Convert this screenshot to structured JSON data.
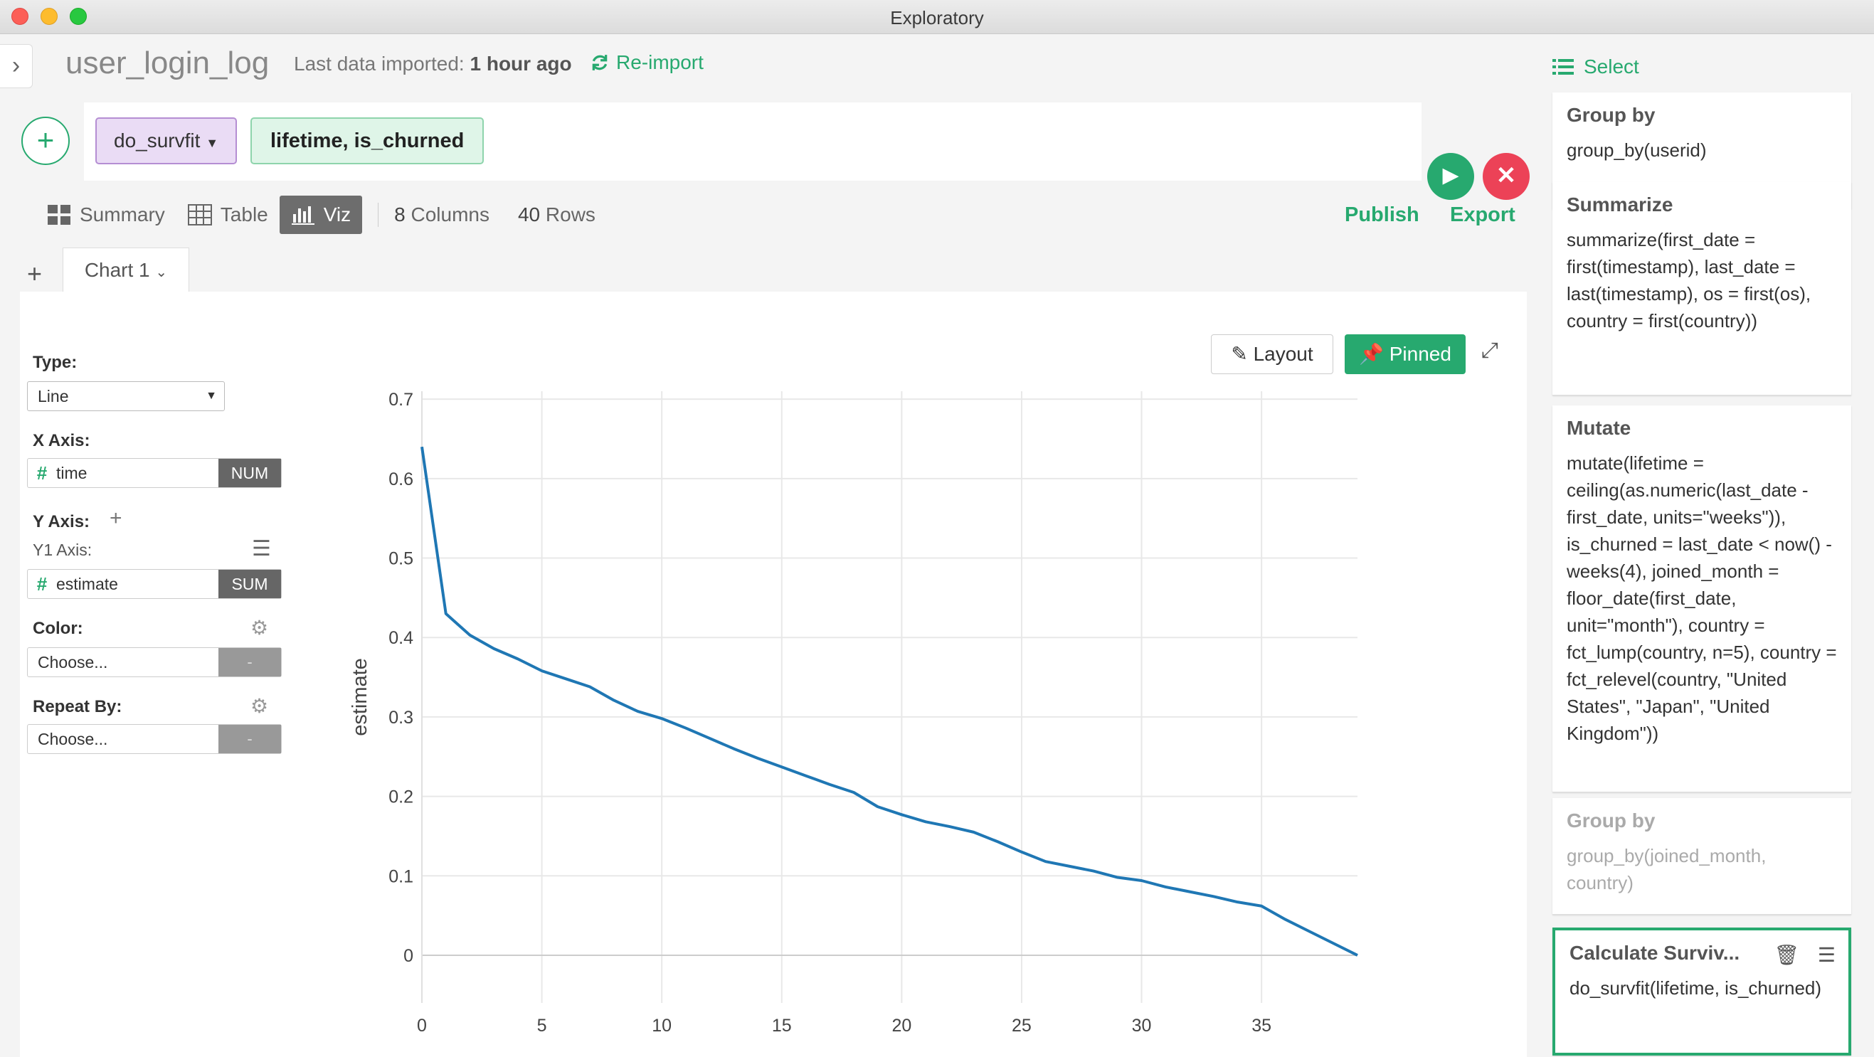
{
  "window": {
    "title": "Exploratory"
  },
  "header": {
    "dataset_name": "user_login_log",
    "last_import_label": "Last data imported:",
    "last_import_value": "1 hour ago",
    "reimport_label": "Re-import"
  },
  "command": {
    "name": "do_survfit",
    "args": "lifetime, is_churned"
  },
  "view_tabs": [
    {
      "label": "Summary"
    },
    {
      "label": "Table"
    },
    {
      "label": "Viz"
    }
  ],
  "stats": {
    "columns_num": "8",
    "columns_label": "Columns",
    "rows_num": "40",
    "rows_label": "Rows"
  },
  "actions": {
    "publish": "Publish",
    "export": "Export"
  },
  "chart_tabs": [
    {
      "label": "Chart 1"
    }
  ],
  "config": {
    "type_label": "Type:",
    "type_value": "Line",
    "x_axis_label": "X Axis:",
    "x_field": "time",
    "x_agg": "NUM",
    "y_axis_label": "Y Axis:",
    "y1_label": "Y1 Axis:",
    "y_field": "estimate",
    "y_agg": "SUM",
    "color_label": "Color:",
    "color_value": "Choose...",
    "repeat_label": "Repeat By:",
    "repeat_value": "Choose...",
    "dash": "-"
  },
  "chart_buttons": {
    "layout": "Layout",
    "pinned": "Pinned"
  },
  "chart_data": {
    "type": "line",
    "xlabel": "time",
    "ylabel": "estimate",
    "xlim": [
      0,
      39
    ],
    "ylim": [
      -0.06,
      0.71
    ],
    "xticks": [
      0,
      5,
      10,
      15,
      20,
      25,
      30,
      35
    ],
    "yticks": [
      0,
      0.1,
      0.2,
      0.3,
      0.4,
      0.5,
      0.6,
      0.7
    ],
    "ytick_labels": [
      "0",
      "0.1",
      "0.2",
      "0.3",
      "0.4",
      "0.5",
      "0.6",
      "0.7"
    ],
    "grid": true,
    "series": [
      {
        "color": "#1f77b4",
        "x": [
          0,
          1,
          2,
          3,
          4,
          5,
          6,
          7,
          8,
          9,
          10,
          11,
          12,
          13,
          14,
          15,
          16,
          17,
          18,
          19,
          20,
          21,
          22,
          23,
          24,
          25,
          26,
          27,
          28,
          29,
          30,
          31,
          32,
          33,
          34,
          35,
          36,
          37,
          38,
          39
        ],
        "y": [
          0.64,
          0.43,
          0.403,
          0.386,
          0.373,
          0.358,
          0.348,
          0.338,
          0.321,
          0.307,
          0.298,
          0.286,
          0.273,
          0.26,
          0.248,
          0.237,
          0.226,
          0.215,
          0.205,
          0.187,
          0.177,
          0.168,
          0.162,
          0.155,
          0.143,
          0.13,
          0.118,
          0.112,
          0.106,
          0.098,
          0.094,
          0.086,
          0.08,
          0.074,
          0.067,
          0.062,
          0.045,
          0.03,
          0.015,
          0.0
        ]
      }
    ]
  },
  "pipeline": {
    "select_label": "Select",
    "steps": [
      {
        "name": "Group by",
        "code": "group_by(userid)"
      },
      {
        "name": "Summarize",
        "code": "summarize(first_date = first(timestamp), last_date = last(timestamp), os = first(os), country = first(country))"
      },
      {
        "name": "Mutate",
        "code": "mutate(lifetime = ceiling(as.numeric(last_date - first_date, units=\"weeks\")), is_churned = last_date < now() - weeks(4), joined_month = floor_date(first_date, unit=\"month\"), country = fct_lump(country, n=5), country = fct_relevel(country, \"United States\", \"Japan\", \"United Kingdom\"))"
      },
      {
        "name": "Group by",
        "code": "group_by(joined_month, country)"
      },
      {
        "name": "Calculate Surviv...",
        "code": "do_survfit(lifetime, is_churned)"
      }
    ]
  }
}
